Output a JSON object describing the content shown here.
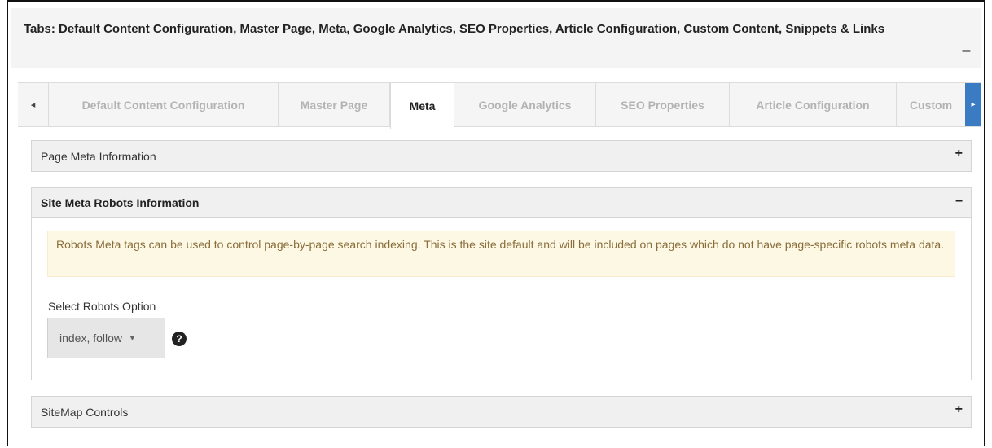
{
  "outer_panel": {
    "title": "Tabs: Default Content Configuration, Master Page, Meta, Google Analytics, SEO Properties, Article Configuration, Custom Content, Snippets & Links",
    "toggle": "–"
  },
  "tabs": {
    "scroll_left": "◂",
    "scroll_right": "▸",
    "items": [
      {
        "label": "Default Content Configuration"
      },
      {
        "label": "Master Page"
      },
      {
        "label": "Meta"
      },
      {
        "label": "Google Analytics"
      },
      {
        "label": "SEO Properties"
      },
      {
        "label": "Article Configuration"
      },
      {
        "label": "Custom"
      }
    ],
    "active": "Meta"
  },
  "panels": {
    "page_meta": {
      "title": "Page Meta Information",
      "toggle": "+"
    },
    "robots": {
      "title": "Site Meta Robots Information",
      "toggle": "–",
      "alert": "Robots Meta tags can be used to control page-by-page search indexing. This is the site default and will be included on pages which do not have page-specific robots meta data.",
      "field_label": "Select Robots Option",
      "select_value": "index, follow",
      "help": "?"
    },
    "sitemap": {
      "title": "SiteMap Controls",
      "toggle": "+"
    }
  },
  "colors": {
    "accent": "#3a7bc4",
    "alert_bg": "#fcf8e3",
    "alert_text": "#8a6d3b"
  }
}
